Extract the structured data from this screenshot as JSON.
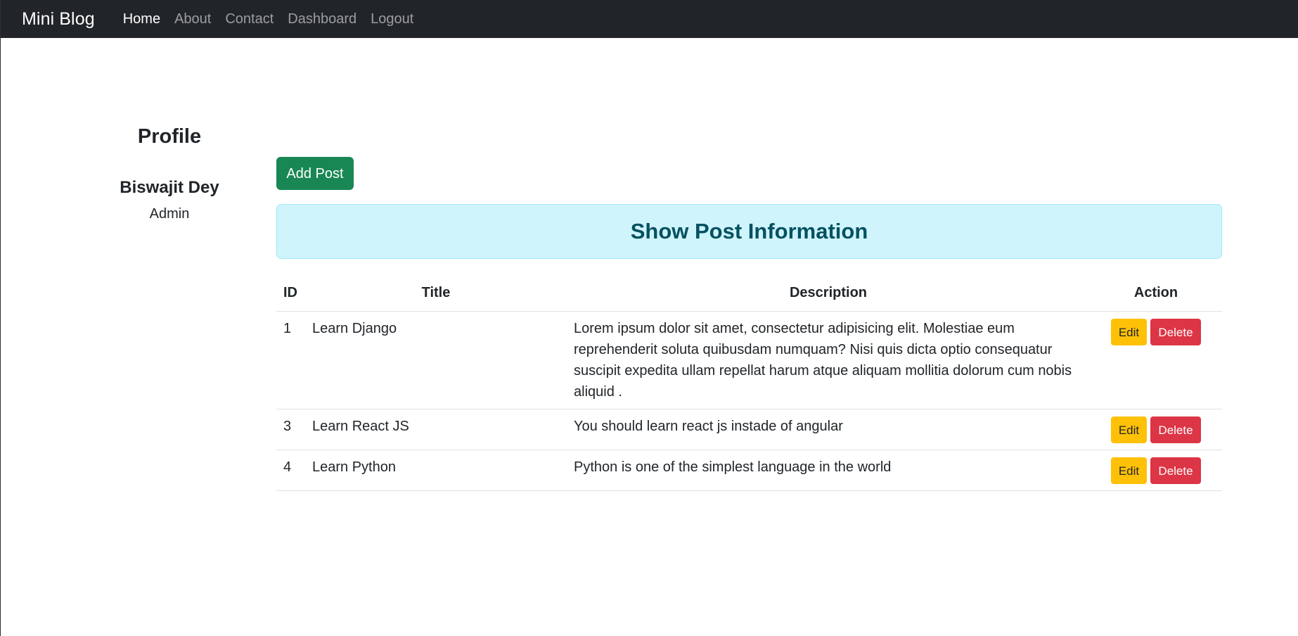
{
  "navbar": {
    "brand": "Mini Blog",
    "links": [
      {
        "label": "Home",
        "active": true
      },
      {
        "label": "About",
        "active": false
      },
      {
        "label": "Contact",
        "active": false
      },
      {
        "label": "Dashboard",
        "active": false
      },
      {
        "label": "Logout",
        "active": false
      }
    ]
  },
  "profile": {
    "heading": "Profile",
    "name": "Biswajit Dey",
    "role": "Admin"
  },
  "main": {
    "add_post_label": "Add Post",
    "banner_title": "Show Post Information",
    "table": {
      "headers": {
        "id": "ID",
        "title": "Title",
        "description": "Description",
        "action": "Action"
      },
      "rows": [
        {
          "id": "1",
          "title": "Learn Django",
          "description": "Lorem ipsum dolor sit amet, consectetur adipisicing elit. Molestiae eum reprehenderit soluta quibusdam numquam? Nisi quis dicta optio consequatur suscipit expedita ullam repellat harum atque aliquam mollitia dolorum cum nobis aliquid .",
          "edit_label": "Edit",
          "delete_label": "Delete"
        },
        {
          "id": "3",
          "title": "Learn React JS",
          "description": "You should learn react js instade of angular",
          "edit_label": "Edit",
          "delete_label": "Delete"
        },
        {
          "id": "4",
          "title": "Learn Python",
          "description": "Python is one of the simplest language in the world",
          "edit_label": "Edit",
          "delete_label": "Delete"
        }
      ]
    }
  },
  "colors": {
    "navbar_bg": "#212529",
    "success": "#198754",
    "info_bg": "#cff4fc",
    "info_text": "#055160",
    "warning": "#ffc107",
    "danger": "#dc3545"
  }
}
